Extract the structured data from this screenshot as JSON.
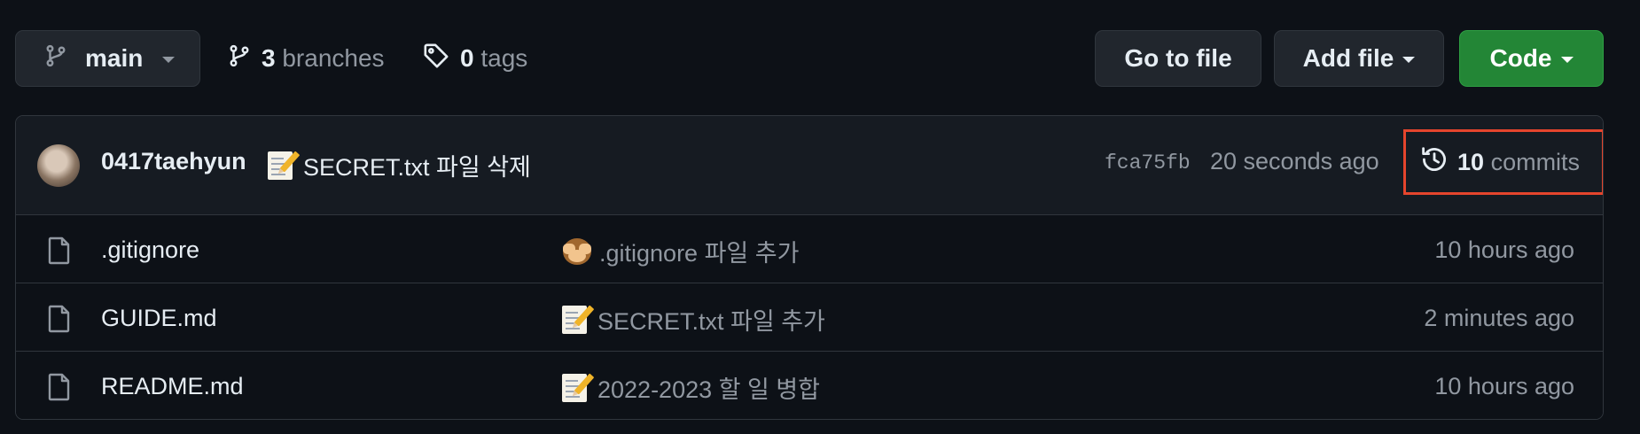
{
  "toolbar": {
    "branch_label": "main",
    "branches_count": "3",
    "branches_label": "branches",
    "tags_count": "0",
    "tags_label": "tags",
    "go_to_file_label": "Go to file",
    "add_file_label": "Add file",
    "code_label": "Code"
  },
  "latest_commit": {
    "author": "0417taehyun",
    "emoji": "memo",
    "message": "SECRET.txt 파일 삭제",
    "sha": "fca75fb",
    "time_ago": "20 seconds ago",
    "commits_count": "10",
    "commits_label": "commits"
  },
  "files": [
    {
      "name": ".gitignore",
      "commit_emoji": "see-no-evil-monkey",
      "commit_message": ".gitignore 파일 추가",
      "time_ago": "10 hours ago"
    },
    {
      "name": "GUIDE.md",
      "commit_emoji": "memo",
      "commit_message": "SECRET.txt 파일 추가",
      "time_ago": "2 minutes ago"
    },
    {
      "name": "README.md",
      "commit_emoji": "memo",
      "commit_message": "2022-2023 할 일 병합",
      "time_ago": "10 hours ago"
    }
  ],
  "colors": {
    "background": "#0d1117",
    "code_button": "#238636",
    "highlight_box": "#e5452d"
  }
}
